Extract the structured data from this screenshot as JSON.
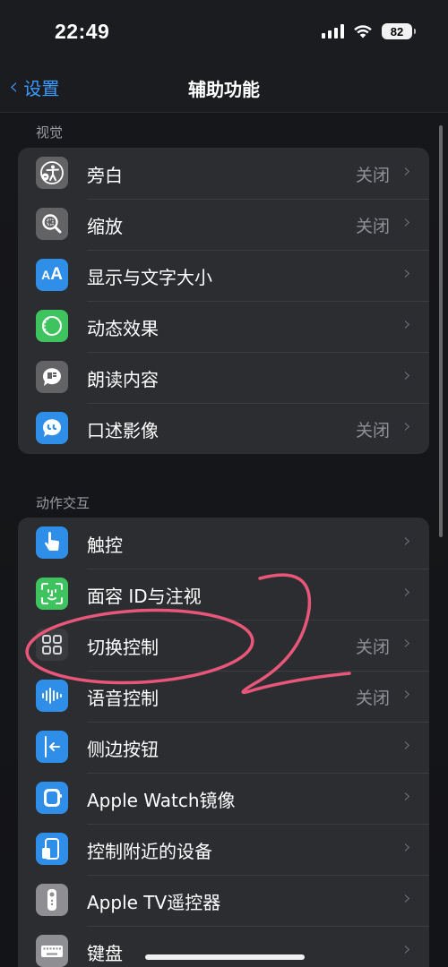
{
  "status_bar": {
    "time": "22:49",
    "battery": "82"
  },
  "nav": {
    "back_label": "设置",
    "title": "辅助功能"
  },
  "colors": {
    "accent": "#3b9bff",
    "annotation": "#e8577a"
  },
  "sections": [
    {
      "header": "视觉",
      "items": [
        {
          "label": "旁白",
          "value": "关闭",
          "icon": "voiceover-icon",
          "icon_color": "#636366"
        },
        {
          "label": "缩放",
          "value": "关闭",
          "icon": "zoom-icon",
          "icon_color": "#636366"
        },
        {
          "label": "显示与文字大小",
          "value": "",
          "icon": "text-size-icon",
          "icon_color": "#2f8fe8"
        },
        {
          "label": "动态效果",
          "value": "",
          "icon": "motion-icon",
          "icon_color": "#3fc35f"
        },
        {
          "label": "朗读内容",
          "value": "",
          "icon": "spoken-content-icon",
          "icon_color": "#636366"
        },
        {
          "label": "口述影像",
          "value": "关闭",
          "icon": "audio-descriptions-icon",
          "icon_color": "#2f8fe8"
        }
      ]
    },
    {
      "header": "动作交互",
      "items": [
        {
          "label": "触控",
          "value": "",
          "icon": "touch-icon",
          "icon_color": "#2f8fe8"
        },
        {
          "label": "面容 ID与注视",
          "value": "",
          "icon": "face-id-icon",
          "icon_color": "#3fc35f"
        },
        {
          "label": "切换控制",
          "value": "关闭",
          "icon": "switch-control-icon",
          "icon_color": "#3a3b3f"
        },
        {
          "label": "语音控制",
          "value": "关闭",
          "icon": "voice-control-icon",
          "icon_color": "#2f8fe8"
        },
        {
          "label": "侧边按钮",
          "value": "",
          "icon": "side-button-icon",
          "icon_color": "#2f8fe8"
        },
        {
          "label": "Apple Watch镜像",
          "value": "",
          "icon": "watch-icon",
          "icon_color": "#2f8fe8"
        },
        {
          "label": "控制附近的设备",
          "value": "",
          "icon": "nearby-devices-icon",
          "icon_color": "#2f8fe8"
        },
        {
          "label": "Apple TV遥控器",
          "value": "",
          "icon": "tv-remote-icon",
          "icon_color": "#8e8e93"
        },
        {
          "label": "键盘",
          "value": "",
          "icon": "keyboard-icon",
          "icon_color": "#8e8e93"
        }
      ]
    }
  ]
}
